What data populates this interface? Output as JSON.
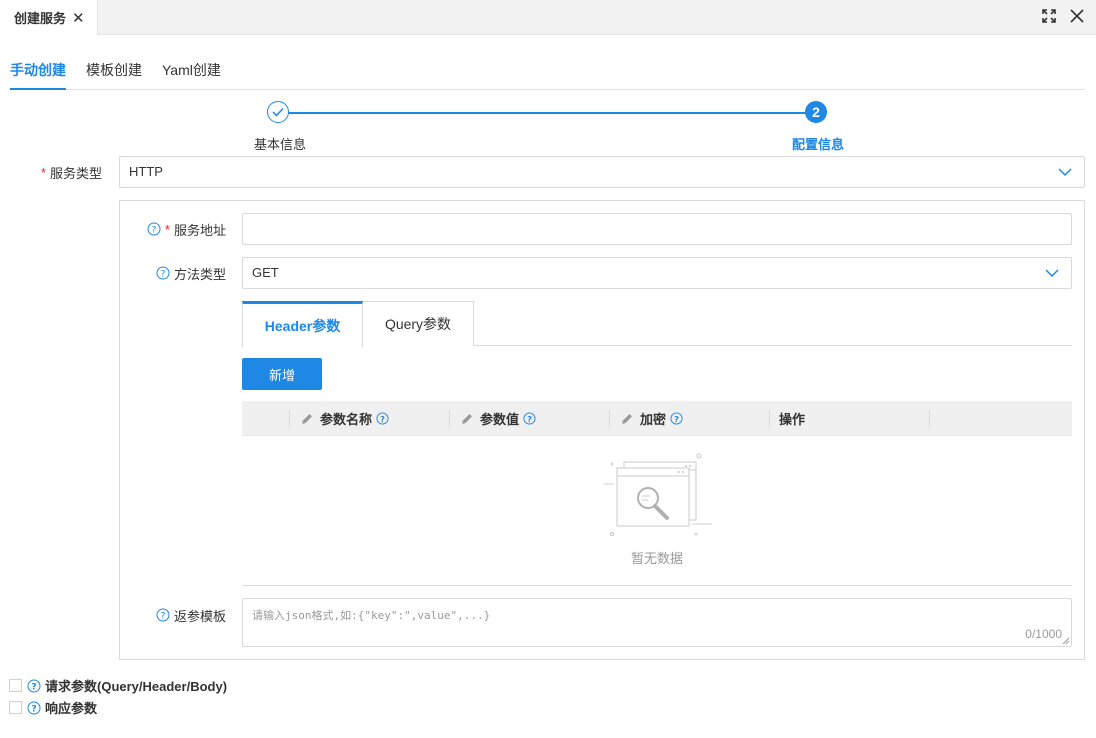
{
  "tabbar": {
    "active_tab": "创建服务",
    "close_symbol": "✕"
  },
  "subtabs": [
    {
      "label": "手动创建"
    },
    {
      "label": "模板创建"
    },
    {
      "label": "Yaml创建"
    }
  ],
  "steps": {
    "step1_label": "基本信息",
    "step2_number": "2",
    "step2_label": "配置信息"
  },
  "form": {
    "service_type_label": "服务类型",
    "service_type_value": "HTTP",
    "service_address_label": "服务地址",
    "service_address_value": "",
    "method_type_label": "方法类型",
    "method_type_value": "GET",
    "return_template_label": "返参模板",
    "return_template_placeholder": "请输入json格式,如:{\"key\":\",value\",...}",
    "return_template_count": "0/1000"
  },
  "param_tabs": [
    {
      "label": "Header参数"
    },
    {
      "label": "Query参数"
    }
  ],
  "add_button": "新增",
  "table": {
    "columns": [
      "参数名称",
      "参数值",
      "加密",
      "操作"
    ]
  },
  "empty_text": "暂无数据",
  "checkboxes": [
    {
      "label": "请求参数(Query/Header/Body)",
      "checked": false
    },
    {
      "label": "响应参数",
      "checked": false
    }
  ],
  "colors": {
    "accent": "#1f88e5",
    "required": "#f5222d"
  }
}
